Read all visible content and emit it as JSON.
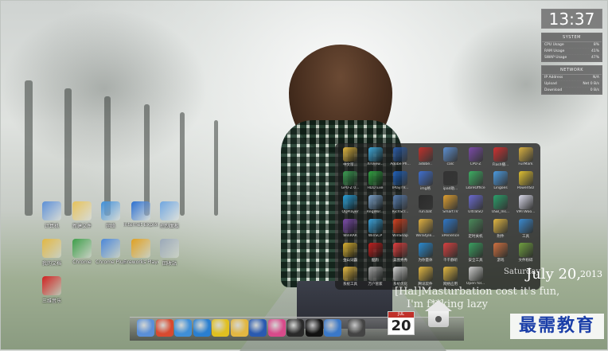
{
  "clock": {
    "time": "13:37"
  },
  "system_panel": {
    "title": "SYSTEM",
    "rows": [
      {
        "label": "CPU Usage",
        "value": "8%"
      },
      {
        "label": "RAM Usage",
        "value": "41%"
      },
      {
        "label": "SWAP Usage",
        "value": "47%"
      }
    ]
  },
  "network_panel": {
    "title": "NETWORK",
    "rows": [
      {
        "label": "IP Address",
        "value": "N/A"
      },
      {
        "label": "Upload",
        "value": "Net 0 B/s"
      },
      {
        "label": "Download",
        "value": "0 B/s"
      }
    ]
  },
  "desktop_icons": [
    {
      "label": "计算机",
      "color": "#5b8fd6"
    },
    {
      "label": "新建文件",
      "color": "#e6c25a"
    },
    {
      "label": "网络",
      "color": "#3f8fd8"
    },
    {
      "label": "Internet Explorer",
      "color": "#2a6fd0"
    },
    {
      "label": "控制面板",
      "color": "#6fa6e0"
    },
    {
      "label": "我的文档",
      "color": "#e2b742"
    },
    {
      "label": "Chrome",
      "color": "#3c9e48"
    },
    {
      "label": "Chrome Plus",
      "color": "#4a86d8"
    },
    {
      "label": "Fireworks Player",
      "color": "#e0a020"
    },
    {
      "label": "回收站",
      "color": "#9aa8b8"
    },
    {
      "label": "三维音乐",
      "color": "#d02020"
    }
  ],
  "launcher": {
    "items": [
      {
        "label": "中文版...",
        "color": "#e0b640"
      },
      {
        "label": "XnView...",
        "color": "#3fa7d8"
      },
      {
        "label": "Adobe Ph...",
        "color": "#2d5ea8"
      },
      {
        "label": "adobe..",
        "color": "#c0302a"
      },
      {
        "label": "calc",
        "color": "#5c8fd0"
      },
      {
        "label": "CPU-Z",
        "color": "#7a4aa8"
      },
      {
        "label": "Flash播...",
        "color": "#d03030"
      },
      {
        "label": "FurMark",
        "color": "#d8b040"
      },
      {
        "label": "GPU-Z 0...",
        "color": "#3a9a50"
      },
      {
        "label": "HDD Exe",
        "color": "#30a040"
      },
      {
        "label": "IPlayTV...",
        "color": "#2060b8"
      },
      {
        "label": "img格",
        "color": "#3f6fd0"
      },
      {
        "label": "ipad助...",
        "color": "#333333"
      },
      {
        "label": "LibreOffice",
        "color": "#3cae62"
      },
      {
        "label": "Lingoes",
        "color": "#4a9ae0"
      },
      {
        "label": "PowerISO",
        "color": "#e0c030"
      },
      {
        "label": "QQPlayer",
        "color": "#2aa0d8"
      },
      {
        "label": "RegWor...",
        "color": "#7aa0c8"
      },
      {
        "label": "RichScr...",
        "color": "#5a7fb0"
      },
      {
        "label": "run.bat",
        "color": "#2a2a2a"
      },
      {
        "label": "SmartTV",
        "color": "#e0a030"
      },
      {
        "label": "UltraISO",
        "color": "#6a6ad0"
      },
      {
        "label": "USB_Ins...",
        "color": "#2aa06a"
      },
      {
        "label": "VMTWoo...",
        "color": "#d8d8e8"
      },
      {
        "label": "WinRAR",
        "color": "#7a4aa8"
      },
      {
        "label": "WinSCP",
        "color": "#3aa0d8"
      },
      {
        "label": "WinSnap",
        "color": "#d04020"
      },
      {
        "label": "WinStyle...",
        "color": "#e0b040"
      },
      {
        "label": "xPerience",
        "color": "#2f78c8"
      },
      {
        "label": "定时关机",
        "color": "#4a8a5a"
      },
      {
        "label": "附件",
        "color": "#e2b742"
      },
      {
        "label": "工具",
        "color": "#3a8ad0"
      },
      {
        "label": "金山词霸",
        "color": "#d8b030"
      },
      {
        "label": "酷狗",
        "color": "#c02020"
      },
      {
        "label": "美图秀秀",
        "color": "#e04040"
      },
      {
        "label": "为你量体",
        "color": "#2a8ad0"
      },
      {
        "label": "千千静听",
        "color": "#d84040"
      },
      {
        "label": "安全工具",
        "color": "#3aa060"
      },
      {
        "label": "游戏",
        "color": "#d07040"
      },
      {
        "label": "文件粉碎",
        "color": "#70a040"
      },
      {
        "label": "系统工具",
        "color": "#e2b742"
      },
      {
        "label": "万户管家",
        "color": "#a0a0a0"
      },
      {
        "label": "系统优化",
        "color": "#d0d0d0"
      },
      {
        "label": "腾讯软件",
        "color": "#e2b742"
      },
      {
        "label": "网络应用",
        "color": "#e2b742"
      },
      {
        "label": "Open fol...",
        "color": "#cccccc"
      }
    ]
  },
  "date": {
    "day": "Saturday",
    "month_day": "July 20,",
    "year": "2013"
  },
  "quote": {
    "line1": "[Hal]Masturbation cost it's fun,",
    "line2": "I'm f**king lazy"
  },
  "watermark": {
    "text": "最需教育"
  },
  "dock": {
    "icons": [
      {
        "name": "finder-icon",
        "color": "#5a8fd8"
      },
      {
        "name": "chrome-icon",
        "color": "#d84a30"
      },
      {
        "name": "chrome-plus-icon",
        "color": "#3f8fd8"
      },
      {
        "name": "kugou-icon",
        "color": "#2a7fd0"
      },
      {
        "name": "qq-icon",
        "color": "#e0c020"
      },
      {
        "name": "folder-icon",
        "color": "#e2b742"
      },
      {
        "name": "word-icon",
        "color": "#2a5ab0"
      },
      {
        "name": "picasa-icon",
        "color": "#d84a8a"
      },
      {
        "name": "monitor-icon",
        "color": "#2a2a2a"
      },
      {
        "name": "terminal-icon",
        "color": "#111111"
      },
      {
        "name": "stack-icon",
        "color": "#3a78c8"
      },
      {
        "name": "gamepad-icon",
        "color": "#444444"
      }
    ],
    "calendar": {
      "month": "JUL",
      "day": "20"
    }
  }
}
